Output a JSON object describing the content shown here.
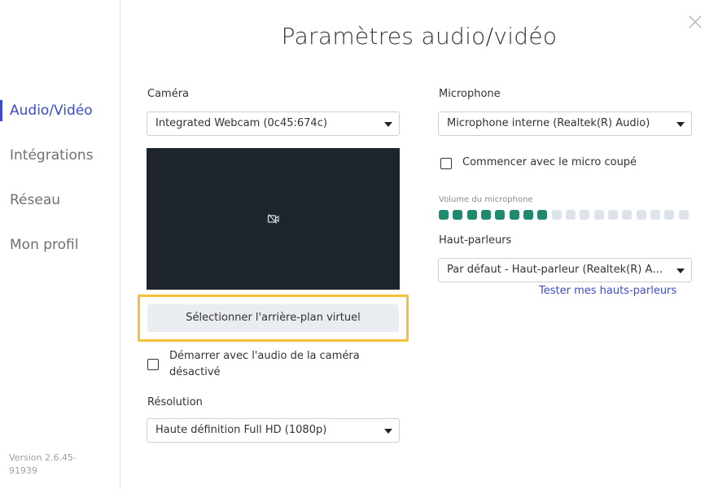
{
  "sidebar": {
    "items": [
      {
        "label": "Audio/Vidéo",
        "active": true
      },
      {
        "label": "Intégrations",
        "active": false
      },
      {
        "label": "Réseau",
        "active": false
      },
      {
        "label": "Mon profil",
        "active": false
      }
    ],
    "version": "Version 2.6.45-91939"
  },
  "dialog": {
    "title": "Paramètres audio/vidéo",
    "close_icon": "close-icon"
  },
  "camera": {
    "label": "Caméra",
    "selected": "Integrated Webcam (0c45:674c)",
    "preview_icon": "camera-off-icon",
    "virtual_bg_button": "Sélectionner l'arrière-plan virtuel",
    "mute_audio_checkbox": {
      "label": "Démarrer avec l'audio de la caméra désactivé",
      "checked": false
    }
  },
  "resolution": {
    "label": "Résolution",
    "selected": "Haute définition Full HD (1080p)"
  },
  "microphone": {
    "label": "Microphone",
    "selected": "Microphone interne (Realtek(R) Audio)",
    "start_muted_checkbox": {
      "label": "Commencer avec le micro coupé",
      "checked": false
    },
    "volume_label": "Volume du microphone",
    "volume_level": {
      "active_segments": 8,
      "total_segments": 18
    },
    "active_color": "#1f8a6e",
    "inactive_color": "#dde3ea"
  },
  "speakers": {
    "label": "Haut-parleurs",
    "selected": "Par défaut - Haut-parleur (Realtek(R) Audio)",
    "test_link": "Tester mes hauts-parleurs"
  },
  "colors": {
    "accent": "#3c4cc8",
    "highlight_border": "#f4bf3a",
    "video_bg": "#1e242c"
  }
}
